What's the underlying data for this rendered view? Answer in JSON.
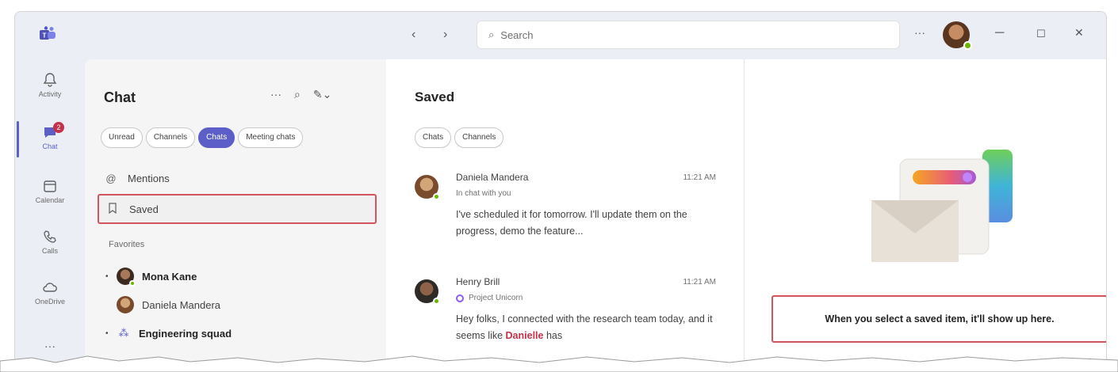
{
  "titlebar": {
    "search_placeholder": "Search",
    "more_label": "···",
    "minimize": "─",
    "maximize": "☐",
    "close": "✕",
    "back": "‹",
    "forward": "›"
  },
  "rail": {
    "items": [
      {
        "label": "Activity",
        "icon": "bell-icon"
      },
      {
        "label": "Chat",
        "icon": "chat-icon",
        "badge": "2"
      },
      {
        "label": "Calendar",
        "icon": "calendar-icon"
      },
      {
        "label": "Calls",
        "icon": "phone-icon"
      },
      {
        "label": "OneDrive",
        "icon": "cloud-icon"
      }
    ],
    "more": "···"
  },
  "chat_panel": {
    "title": "Chat",
    "filters": [
      "Unread",
      "Channels",
      "Chats",
      "Meeting chats"
    ],
    "active_filter": "Chats",
    "mentions_label": "Mentions",
    "saved_label": "Saved",
    "favorites_label": "Favorites",
    "favorites": [
      {
        "name": "Mona Kane",
        "bold": true
      },
      {
        "name": "Daniela Mandera",
        "bold": false
      },
      {
        "name": "Engineering squad",
        "bold": true
      }
    ]
  },
  "saved_panel": {
    "title": "Saved",
    "filters": [
      "Chats",
      "Channels"
    ],
    "messages": [
      {
        "sender": "Daniela Mandera",
        "time": "11:21 AM",
        "context": "In chat with you",
        "body": "I've scheduled it for tomorrow. I'll update them on the progress, demo the feature..."
      },
      {
        "sender": "Henry Brill",
        "time": "11:21 AM",
        "context": "Project Unicorn",
        "body_before": "Hey folks, I connected with the research team today, and it seems like ",
        "mention": "Danielle",
        "body_after": " has"
      }
    ]
  },
  "detail_panel": {
    "empty_message": "When you select a saved item, it'll show up here."
  },
  "colors": {
    "accent": "#5b5fc7",
    "highlight_border": "#d2545d",
    "presence": "#6bb700",
    "badge": "#c4314b"
  }
}
